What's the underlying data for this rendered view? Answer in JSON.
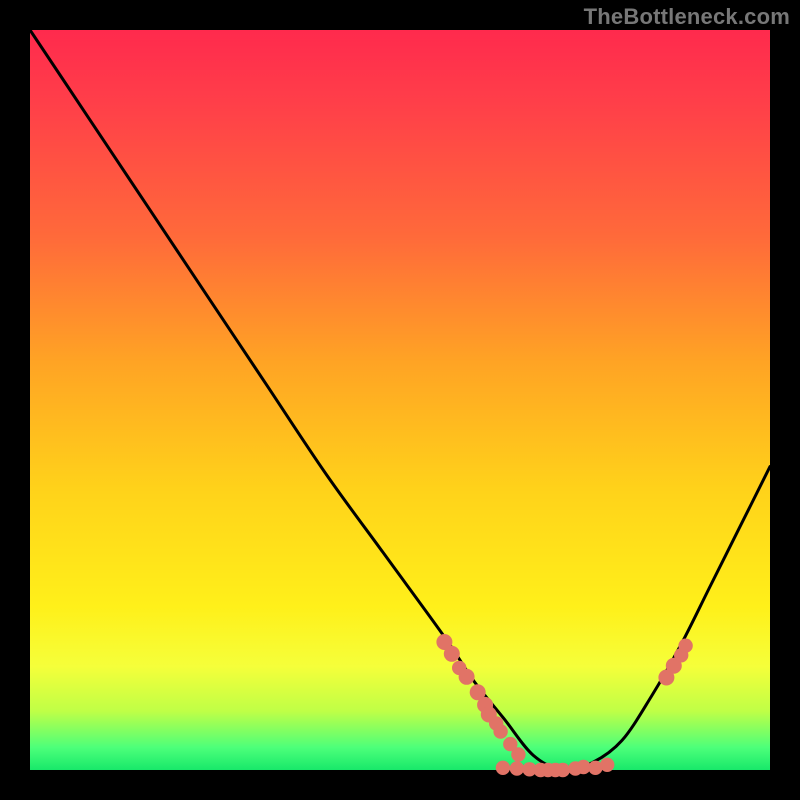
{
  "attribution": "TheBottleneck.com",
  "colors": {
    "page_background": "#000000",
    "gradient_top": "#ff2a4d",
    "gradient_bottom": "#18e86a",
    "curve_stroke": "#000000",
    "marker_fill": "#e17366"
  },
  "chart_data": {
    "type": "line",
    "title": "",
    "xlabel": "",
    "ylabel": "",
    "xlim": [
      0,
      100
    ],
    "ylim": [
      0,
      100
    ],
    "grid": false,
    "legend": false,
    "y_note": "y is an arbitrary percentage scale where 100 is top of plot and 0 is bottom; curve represents a U-shaped bottleneck profile with minimum near x≈70",
    "series": [
      {
        "name": "bottleneck-curve",
        "x": [
          0,
          8,
          16,
          24,
          32,
          40,
          48,
          56,
          60,
          64,
          68,
          72,
          76,
          80,
          84,
          88,
          92,
          96,
          100
        ],
        "y": [
          100,
          88,
          76,
          64,
          52,
          40,
          29,
          18,
          12,
          7,
          2,
          0,
          1,
          4,
          10,
          17,
          25,
          33,
          41
        ]
      }
    ],
    "scatter_points": {
      "name": "highlight-markers",
      "note": "peach markers overlaid on the curve near the valley and right wall",
      "points": [
        {
          "x": 56,
          "y": 17.3,
          "r": 1.0
        },
        {
          "x": 57,
          "y": 15.7,
          "r": 1.0
        },
        {
          "x": 58,
          "y": 13.8,
          "r": 0.9
        },
        {
          "x": 59,
          "y": 12.6,
          "r": 1.0
        },
        {
          "x": 60.5,
          "y": 10.5,
          "r": 1.0
        },
        {
          "x": 61.5,
          "y": 8.8,
          "r": 1.0
        },
        {
          "x": 62,
          "y": 7.5,
          "r": 1.0
        },
        {
          "x": 63,
          "y": 6.3,
          "r": 0.9
        },
        {
          "x": 63.6,
          "y": 5.2,
          "r": 0.9
        },
        {
          "x": 64.9,
          "y": 3.5,
          "r": 0.9
        },
        {
          "x": 66,
          "y": 2.1,
          "r": 0.9
        },
        {
          "x": 63.9,
          "y": 0.3,
          "r": 0.9
        },
        {
          "x": 65.8,
          "y": 0.2,
          "r": 0.9
        },
        {
          "x": 67.5,
          "y": 0.1,
          "r": 0.9
        },
        {
          "x": 69,
          "y": 0.0,
          "r": 0.9
        },
        {
          "x": 70,
          "y": 0.0,
          "r": 0.9
        },
        {
          "x": 71,
          "y": 0.0,
          "r": 0.9
        },
        {
          "x": 72,
          "y": 0.0,
          "r": 0.9
        },
        {
          "x": 73.7,
          "y": 0.2,
          "r": 0.9
        },
        {
          "x": 74.8,
          "y": 0.4,
          "r": 0.9
        },
        {
          "x": 76.4,
          "y": 0.3,
          "r": 0.9
        },
        {
          "x": 78,
          "y": 0.7,
          "r": 0.9
        },
        {
          "x": 86,
          "y": 12.5,
          "r": 1.0
        },
        {
          "x": 87,
          "y": 14.1,
          "r": 1.0
        },
        {
          "x": 88,
          "y": 15.5,
          "r": 0.9
        },
        {
          "x": 88.6,
          "y": 16.8,
          "r": 0.9
        }
      ]
    }
  }
}
